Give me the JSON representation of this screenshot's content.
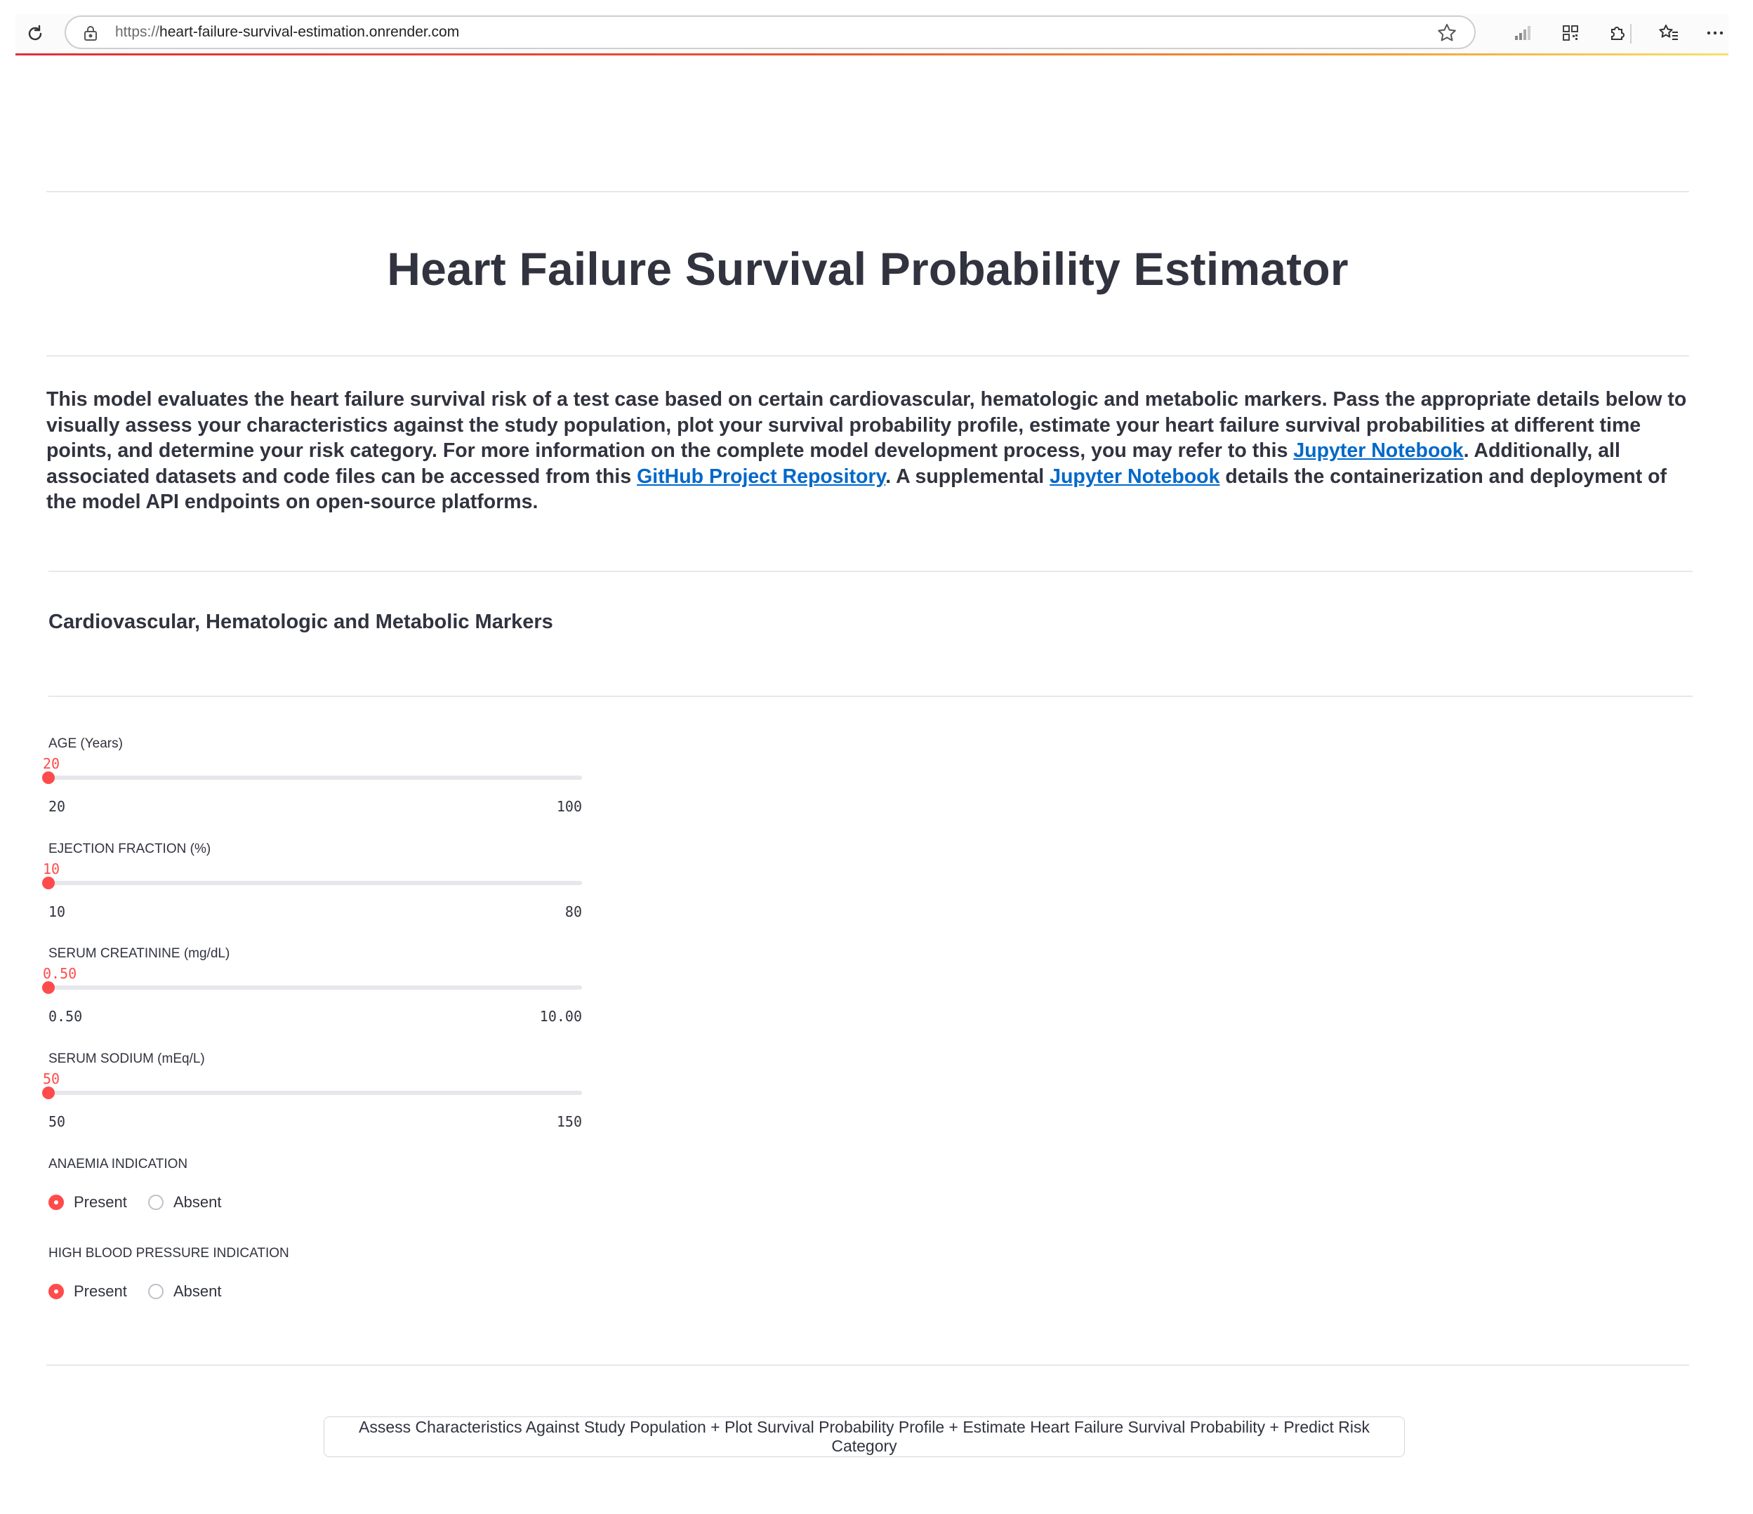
{
  "browser": {
    "url_scheme": "https://",
    "url_host": "heart-failure-survival-estimation.onrender.com",
    "icons": {
      "reload": "reload-icon",
      "lock": "lock-icon",
      "favorite": "star-icon",
      "signal": "signal-bars-icon",
      "qr": "qr-code-icon",
      "extensions": "puzzle-icon",
      "favorites": "favorites-list-icon",
      "more": "more-dots-icon"
    },
    "progress_colors": [
      "#e0303a",
      "#f2a036",
      "#f6e26c"
    ]
  },
  "page": {
    "title": "Heart Failure Survival Probability Estimator",
    "intro": {
      "p1": "This model evaluates the heart failure survival risk of a test case based on certain cardiovascular, hematologic and metabolic markers. Pass the appropriate details below to visually assess your characteristics against the study population, plot your survival probability profile, estimate your heart failure survival probabilities at different time points, and determine your risk category. For more information on the complete model development process, you may refer to this ",
      "link1": "Jupyter Notebook",
      "p2": ". Additionally, all associated datasets and code files can be accessed from this ",
      "link2": "GitHub Project Repository",
      "p3": ". A supplemental ",
      "link3": "Jupyter Notebook",
      "p4": " details the containerization and deployment of the model API endpoints on open-source platforms."
    },
    "section_heading": "Cardiovascular, Hematologic and Metabolic Markers",
    "accent_color": "#ff4b4b",
    "link_color": "#0068c9"
  },
  "sliders": [
    {
      "label": "AGE (Years)",
      "value": "20",
      "min": "20",
      "max": "100",
      "fraction": 0
    },
    {
      "label": "EJECTION FRACTION (%)",
      "value": "10",
      "min": "10",
      "max": "80",
      "fraction": 0
    },
    {
      "label": "SERUM CREATININE (mg/dL)",
      "value": "0.50",
      "min": "0.50",
      "max": "10.00",
      "fraction": 0
    },
    {
      "label": "SERUM SODIUM (mEq/L)",
      "value": "50",
      "min": "50",
      "max": "150",
      "fraction": 0
    }
  ],
  "radios": [
    {
      "label": "ANAEMIA INDICATION",
      "options": [
        "Present",
        "Absent"
      ],
      "selected": "Present"
    },
    {
      "label": "HIGH BLOOD PRESSURE INDICATION",
      "options": [
        "Present",
        "Absent"
      ],
      "selected": "Present"
    }
  ],
  "action_button": {
    "label": "Assess Characteristics Against Study Population + Plot Survival Probability Profile + Estimate Heart Failure Survival Probability + Predict Risk Category"
  }
}
